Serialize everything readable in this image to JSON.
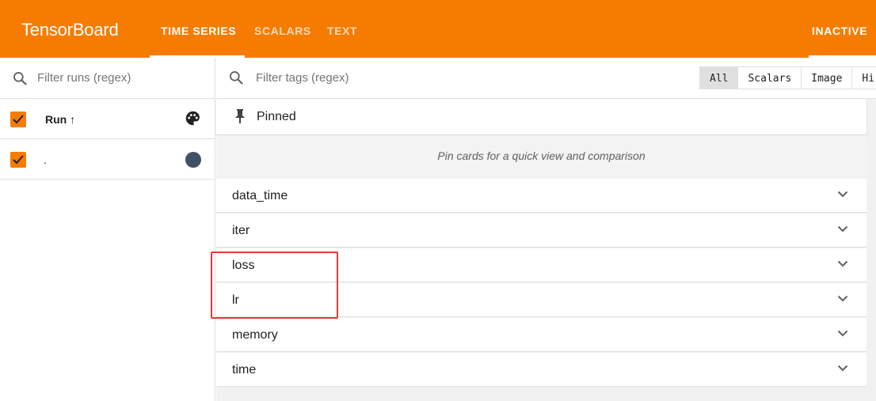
{
  "header": {
    "brand": "TensorBoard",
    "tabs": [
      {
        "label": "TIME SERIES",
        "active": true
      },
      {
        "label": "SCALARS",
        "active": false
      },
      {
        "label": "TEXT",
        "active": false
      }
    ],
    "status": "INACTIVE",
    "color": "#f57c00"
  },
  "runs_panel": {
    "search_placeholder": "Filter runs (regex)",
    "header_label": "Run ↑",
    "runs": [
      {
        "name": ".",
        "checked": true,
        "color": "#425066"
      }
    ]
  },
  "main": {
    "search_placeholder": "Filter tags (regex)",
    "filter_buttons": [
      {
        "label": "All",
        "active": true
      },
      {
        "label": "Scalars",
        "active": false
      },
      {
        "label": "Image",
        "active": false
      },
      {
        "label": "Hi",
        "active": false
      }
    ],
    "pinned": {
      "title": "Pinned",
      "hint": "Pin cards for a quick view and comparison"
    },
    "groups": [
      "data_time",
      "iter",
      "loss",
      "lr",
      "memory",
      "time"
    ]
  },
  "annotation": {
    "color": "#e53935",
    "highlighted_groups": [
      "loss",
      "lr"
    ]
  }
}
